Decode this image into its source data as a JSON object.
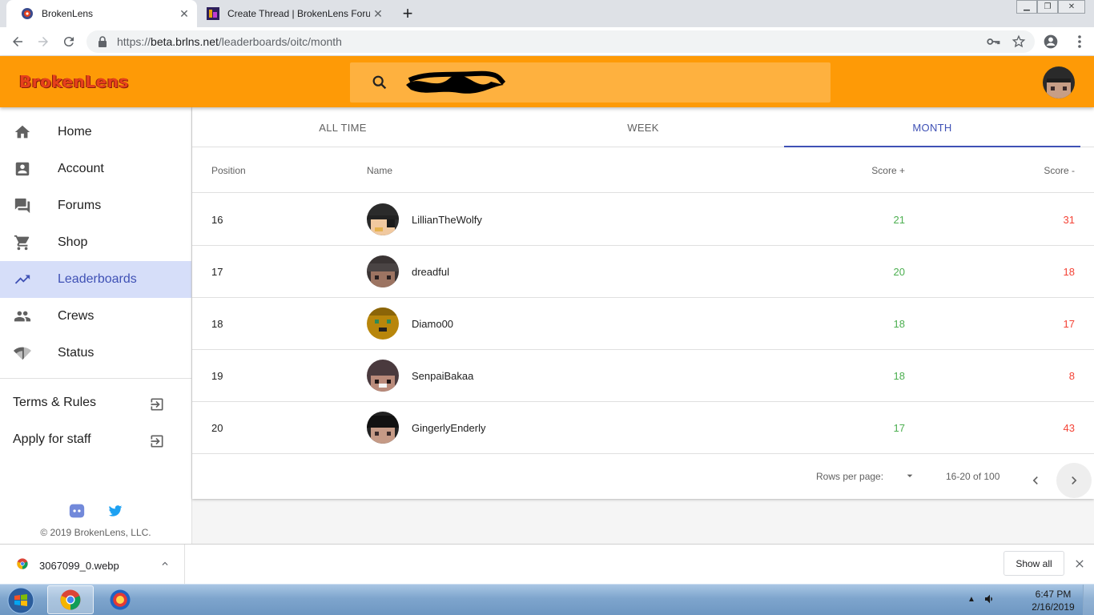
{
  "browser": {
    "tabs": [
      {
        "title": "BrokenLens",
        "active": true
      },
      {
        "title": "Create Thread | BrokenLens Forum",
        "active": false
      }
    ],
    "url_prefix": "https://",
    "url_host": "beta.brlns.net",
    "url_path": "/leaderboards/oitc/month"
  },
  "header": {
    "brand": "BrokenLens",
    "search_value": ""
  },
  "sidebar": {
    "items": [
      {
        "label": "Home",
        "icon": "home-icon"
      },
      {
        "label": "Account",
        "icon": "account-icon"
      },
      {
        "label": "Forums",
        "icon": "forum-icon"
      },
      {
        "label": "Shop",
        "icon": "cart-icon"
      },
      {
        "label": "Leaderboards",
        "icon": "trending-up-icon",
        "active": true
      },
      {
        "label": "Crews",
        "icon": "people-icon"
      },
      {
        "label": "Status",
        "icon": "signal-icon"
      }
    ],
    "links": [
      {
        "label": "Terms & Rules"
      },
      {
        "label": "Apply for staff"
      }
    ],
    "copyright": "© 2019 BrokenLens, LLC."
  },
  "leaderboard": {
    "tabs": [
      "ALL TIME",
      "WEEK",
      "MONTH"
    ],
    "active_tab": "MONTH",
    "columns": {
      "position": "Position",
      "name": "Name",
      "score_plus": "Score +",
      "score_minus": "Score -"
    },
    "rows": [
      {
        "position": "16",
        "name": "LillianTheWolfy",
        "score_plus": "21",
        "score_minus": "31"
      },
      {
        "position": "17",
        "name": "dreadful",
        "score_plus": "20",
        "score_minus": "18"
      },
      {
        "position": "18",
        "name": "Diamo00",
        "score_plus": "18",
        "score_minus": "17"
      },
      {
        "position": "19",
        "name": "SenpaiBakaa",
        "score_plus": "18",
        "score_minus": "8"
      },
      {
        "position": "20",
        "name": "GingerlyEnderly",
        "score_plus": "17",
        "score_minus": "43"
      }
    ],
    "pagination": {
      "rows_per_page_label": "Rows per page:",
      "range": "16-20 of 100"
    }
  },
  "downloads": {
    "file": "3067099_0.webp",
    "show_all": "Show all"
  },
  "taskbar": {
    "time": "6:47 PM",
    "date": "2/16/2019"
  },
  "colors": {
    "brand_orange": "#fe9a06",
    "accent_indigo": "#3f51b5",
    "score_plus": "#4caf50",
    "score_minus": "#f44336"
  }
}
